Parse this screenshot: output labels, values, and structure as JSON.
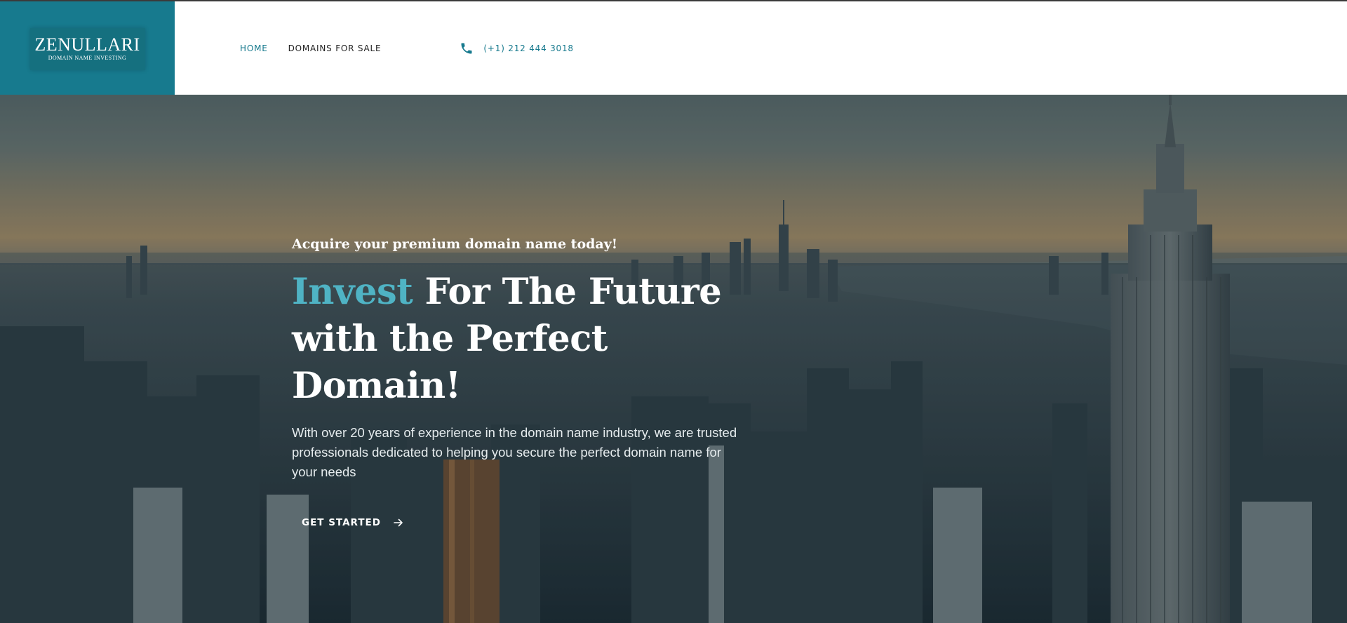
{
  "brand": {
    "name": "ZENULLARI",
    "tagline": "DOMAIN NAME INVESTING"
  },
  "nav": {
    "items": [
      {
        "label": "HOME",
        "active": true
      },
      {
        "label": "DOMAINS FOR SALE",
        "active": false
      }
    ]
  },
  "contact": {
    "phone": "(+1) 212 444 3018",
    "icon": "phone-icon"
  },
  "hero": {
    "eyebrow": "Acquire your premium domain name today!",
    "title_accent": "Invest",
    "title_rest": " For The Future with the Perfect Domain!",
    "description": "With over 20 years of experience in the domain name industry, we are trusted professionals dedicated to helping you secure the perfect domain name for your needs",
    "cta_label": "GET STARTED",
    "cta_icon": "arrow-right-icon",
    "background": "city-skyline-photo"
  },
  "colors": {
    "brand_teal": "#177a8e",
    "accent_cyan": "#4fb3c4",
    "header_bg": "#ffffff",
    "text_dark": "#222222"
  }
}
